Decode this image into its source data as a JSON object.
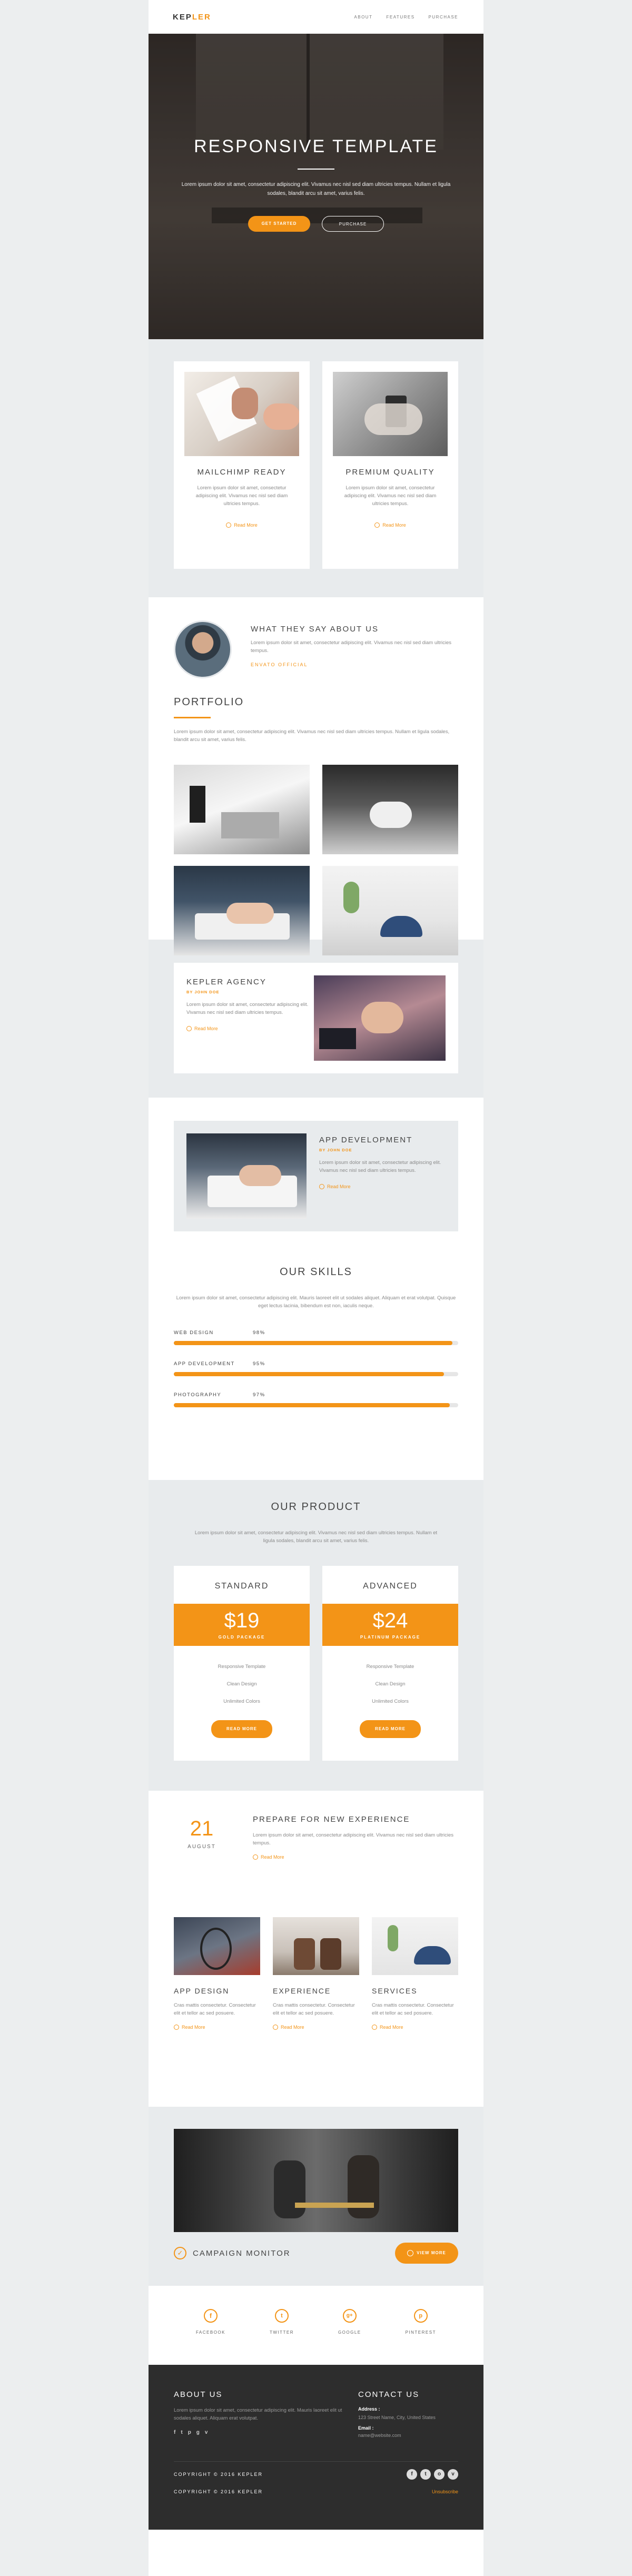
{
  "brand": {
    "part1": "KEP",
    "part2": "LER"
  },
  "nav": [
    {
      "label": "ABOUT"
    },
    {
      "label": "FEATURES"
    },
    {
      "label": "PURCHASE"
    }
  ],
  "hero": {
    "title": "RESPONSIVE TEMPLATE",
    "text": "Lorem ipsum dolor sit amet, consectetur adipiscing elit. Vivamus nec nisl sed diam ultricies tempus. Nullam et ligula sodales, blandit arcu sit amet, varius felis.",
    "btn_primary": "GET STARTED",
    "btn_secondary": "PURCHASE"
  },
  "features": [
    {
      "title": "MAILCHIMP READY",
      "text": "Lorem ipsum dolor sit amet, consectetur adipiscing elit. Vivamus nec nisl sed diam ultricies tempus.",
      "link": "Read More"
    },
    {
      "title": "PREMIUM QUALITY",
      "text": "Lorem ipsum dolor sit amet, consectetur adipiscing elit. Vivamus nec nisl sed diam ultricies tempus.",
      "link": "Read More"
    }
  ],
  "testimonial": {
    "title": "WHAT THEY SAY ABOUT US",
    "text": "Lorem ipsum dolor sit amet, consectetur adipiscing elit. Vivamus nec nisl sed diam ultricies tempus.",
    "author": "ENVATO OFFICIAL"
  },
  "portfolio": {
    "title": "PORTFOLIO",
    "text": "Lorem ipsum dolor sit amet, consectetur adipiscing elit. Vivamus nec nisl sed diam ultricies tempus. Nullam et ligula sodales, blandit arcu sit amet, varius felis."
  },
  "agency": {
    "title": "KEPLER AGENCY",
    "by": "BY JOHN DOE",
    "text": "Lorem ipsum dolor sit amet, consectetur adipiscing elit. Vivamus nec nisl sed diam ultricies tempus.",
    "link": "Read More"
  },
  "appdev": {
    "title": "APP DEVELOPMENT",
    "by": "BY JOHN DOE",
    "text": "Lorem ipsum dolor sit amet, consectetur adipiscing elit. Vivamus nec nisl sed diam ultricies tempus.",
    "link": "Read More"
  },
  "skills": {
    "title": "OUR SKILLS",
    "text": "Lorem ipsum dolor sit amet, consectetur adipiscing elit. Mauris laoreet elit ut sodales aliquet. Aliquam et erat volutpat. Quisque eget lectus lacinia, bibendum est non, iaculis neque.",
    "items": [
      {
        "label": "WEB DESIGN",
        "pct": "98%",
        "value": 98
      },
      {
        "label": "APP DEVELOPMENT",
        "pct": "95%",
        "value": 95
      },
      {
        "label": "PHOTOGRAPHY",
        "pct": "97%",
        "value": 97
      }
    ]
  },
  "product": {
    "title": "OUR PRODUCT",
    "text": "Lorem ipsum dolor sit amet, consectetur adipiscing elit. Vivamus nec nisl sed diam ultricies tempus. Nullam et ligula sodales, blandit arcu sit amet, varius felis.",
    "plans": [
      {
        "name": "STANDARD",
        "price": "$19",
        "tier": "GOLD PACKAGE",
        "f1": "Responsive Template",
        "f2": "Clean Design",
        "f3": "Unlimited Colors",
        "btn": "READ MORE"
      },
      {
        "name": "ADVANCED",
        "price": "$24",
        "tier": "PLATINUM PACKAGE",
        "f1": "Responsive Template",
        "f2": "Clean Design",
        "f3": "Unlimited Colors",
        "btn": "READ MORE"
      }
    ]
  },
  "event": {
    "day": "21",
    "month": "AUGUST",
    "title": "PREPARE FOR NEW EXPERIENCE",
    "text": "Lorem ipsum dolor sit amet, consectetur adipiscing elit. Vivamus nec nisl sed diam ultricies tempus.",
    "link": "Read More"
  },
  "columns": [
    {
      "title": "APP DESIGN",
      "text": "Cras mattis consectetur. Consectetur elit et tellor ac sed posuere.",
      "link": "Read More"
    },
    {
      "title": "EXPERIENCE",
      "text": "Cras mattis consectetur. Consectetur elit et tellor ac sed posuere.",
      "link": "Read More"
    },
    {
      "title": "SERVICES",
      "text": "Cras mattis consectetur. Consectetur elit et tellor ac sed posuere.",
      "link": "Read More"
    }
  ],
  "campaign": {
    "label": "CAMPAIGN MONITOR",
    "btn": "VIEW MORE"
  },
  "social": [
    {
      "label": "FACEBOOK",
      "icon": "facebook-icon"
    },
    {
      "label": "TWITTER",
      "icon": "twitter-icon"
    },
    {
      "label": "GOOGLE",
      "icon": "google-icon"
    },
    {
      "label": "PINTEREST",
      "icon": "pinterest-icon"
    }
  ],
  "footer": {
    "about_title": "ABOUT US",
    "about_text": "Lorem ipsum dolor sit amet, consectetur adipiscing elit. Mauris laoreet elit ut sodales aliquet. Aliquam erat volutpat.",
    "contact_title": "CONTACT US",
    "address_label": "Address :",
    "address": "123 Street Name, City, United States",
    "email_label": "Email :",
    "email": "name@website.com",
    "copyright1": "COPYRIGHT © 2016 KEPLER",
    "copyright2": "COPYRIGHT © 2016 KEPLER",
    "unsubscribe": "Unsubscribe"
  },
  "colors": {
    "accent": "#f39417",
    "dark": "#2d2d2d",
    "gray_bg": "#e8ebed"
  }
}
